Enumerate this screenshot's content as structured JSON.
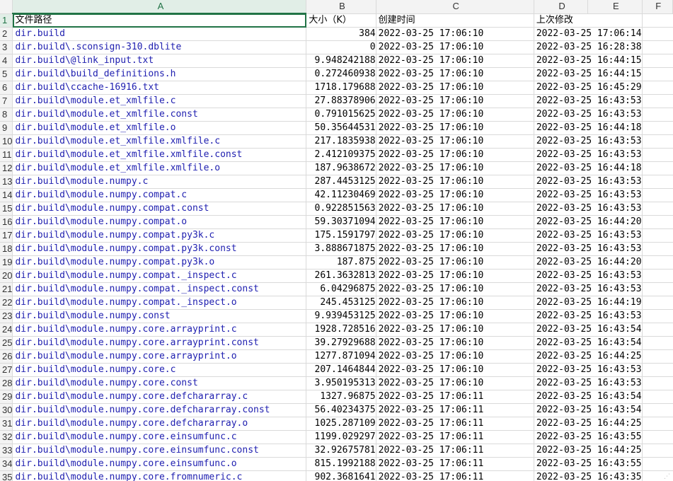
{
  "columns": [
    "A",
    "B",
    "C",
    "D",
    "E",
    "F"
  ],
  "selected_column": "A",
  "header_row": {
    "row": "1",
    "path": "文件路径",
    "size": "大小（K）",
    "created": "创建时间",
    "modified": "上次修改"
  },
  "rows": [
    {
      "row": "2",
      "path": "dir.build",
      "size": "384",
      "created": "2022-03-25 17:06:10",
      "modified": "2022-03-25 17:06:14"
    },
    {
      "row": "3",
      "path": "dir.build\\.sconsign-310.dblite",
      "size": "0",
      "created": "2022-03-25 17:06:10",
      "modified": "2022-03-25 16:28:38"
    },
    {
      "row": "4",
      "path": "dir.build\\@link_input.txt",
      "size": "9.948242188",
      "created": "2022-03-25 17:06:10",
      "modified": "2022-03-25 16:44:15"
    },
    {
      "row": "5",
      "path": "dir.build\\build_definitions.h",
      "size": "0.272460938",
      "created": "2022-03-25 17:06:10",
      "modified": "2022-03-25 16:44:15"
    },
    {
      "row": "6",
      "path": "dir.build\\ccache-16916.txt",
      "size": "1718.179688",
      "created": "2022-03-25 17:06:10",
      "modified": "2022-03-25 16:45:29"
    },
    {
      "row": "7",
      "path": "dir.build\\module.et_xmlfile.c",
      "size": "27.88378906",
      "created": "2022-03-25 17:06:10",
      "modified": "2022-03-25 16:43:53"
    },
    {
      "row": "8",
      "path": "dir.build\\module.et_xmlfile.const",
      "size": "0.791015625",
      "created": "2022-03-25 17:06:10",
      "modified": "2022-03-25 16:43:53"
    },
    {
      "row": "9",
      "path": "dir.build\\module.et_xmlfile.o",
      "size": "50.35644531",
      "created": "2022-03-25 17:06:10",
      "modified": "2022-03-25 16:44:18"
    },
    {
      "row": "10",
      "path": "dir.build\\module.et_xmlfile.xmlfile.c",
      "size": "217.1835938",
      "created": "2022-03-25 17:06:10",
      "modified": "2022-03-25 16:43:53"
    },
    {
      "row": "11",
      "path": "dir.build\\module.et_xmlfile.xmlfile.const",
      "size": "2.412109375",
      "created": "2022-03-25 17:06:10",
      "modified": "2022-03-25 16:43:53"
    },
    {
      "row": "12",
      "path": "dir.build\\module.et_xmlfile.xmlfile.o",
      "size": "187.9638672",
      "created": "2022-03-25 17:06:10",
      "modified": "2022-03-25 16:44:18"
    },
    {
      "row": "13",
      "path": "dir.build\\module.numpy.c",
      "size": "287.4453125",
      "created": "2022-03-25 17:06:10",
      "modified": "2022-03-25 16:43:53"
    },
    {
      "row": "14",
      "path": "dir.build\\module.numpy.compat.c",
      "size": "42.11230469",
      "created": "2022-03-25 17:06:10",
      "modified": "2022-03-25 16:43:53"
    },
    {
      "row": "15",
      "path": "dir.build\\module.numpy.compat.const",
      "size": "0.922851563",
      "created": "2022-03-25 17:06:10",
      "modified": "2022-03-25 16:43:53"
    },
    {
      "row": "16",
      "path": "dir.build\\module.numpy.compat.o",
      "size": "59.30371094",
      "created": "2022-03-25 17:06:10",
      "modified": "2022-03-25 16:44:20"
    },
    {
      "row": "17",
      "path": "dir.build\\module.numpy.compat.py3k.c",
      "size": "175.1591797",
      "created": "2022-03-25 17:06:10",
      "modified": "2022-03-25 16:43:53"
    },
    {
      "row": "18",
      "path": "dir.build\\module.numpy.compat.py3k.const",
      "size": "3.888671875",
      "created": "2022-03-25 17:06:10",
      "modified": "2022-03-25 16:43:53"
    },
    {
      "row": "19",
      "path": "dir.build\\module.numpy.compat.py3k.o",
      "size": "187.875",
      "created": "2022-03-25 17:06:10",
      "modified": "2022-03-25 16:44:20"
    },
    {
      "row": "20",
      "path": "dir.build\\module.numpy.compat._inspect.c",
      "size": "261.3632813",
      "created": "2022-03-25 17:06:10",
      "modified": "2022-03-25 16:43:53"
    },
    {
      "row": "21",
      "path": "dir.build\\module.numpy.compat._inspect.const",
      "size": "6.04296875",
      "created": "2022-03-25 17:06:10",
      "modified": "2022-03-25 16:43:53"
    },
    {
      "row": "22",
      "path": "dir.build\\module.numpy.compat._inspect.o",
      "size": "245.453125",
      "created": "2022-03-25 17:06:10",
      "modified": "2022-03-25 16:44:19"
    },
    {
      "row": "23",
      "path": "dir.build\\module.numpy.const",
      "size": "9.939453125",
      "created": "2022-03-25 17:06:10",
      "modified": "2022-03-25 16:43:53"
    },
    {
      "row": "24",
      "path": "dir.build\\module.numpy.core.arrayprint.c",
      "size": "1928.728516",
      "created": "2022-03-25 17:06:10",
      "modified": "2022-03-25 16:43:54"
    },
    {
      "row": "25",
      "path": "dir.build\\module.numpy.core.arrayprint.const",
      "size": "39.27929688",
      "created": "2022-03-25 17:06:10",
      "modified": "2022-03-25 16:43:54"
    },
    {
      "row": "26",
      "path": "dir.build\\module.numpy.core.arrayprint.o",
      "size": "1277.871094",
      "created": "2022-03-25 17:06:10",
      "modified": "2022-03-25 16:44:25"
    },
    {
      "row": "27",
      "path": "dir.build\\module.numpy.core.c",
      "size": "207.1464844",
      "created": "2022-03-25 17:06:10",
      "modified": "2022-03-25 16:43:53"
    },
    {
      "row": "28",
      "path": "dir.build\\module.numpy.core.const",
      "size": "3.950195313",
      "created": "2022-03-25 17:06:10",
      "modified": "2022-03-25 16:43:53"
    },
    {
      "row": "29",
      "path": "dir.build\\module.numpy.core.defchararray.c",
      "size": "1327.96875",
      "created": "2022-03-25 17:06:11",
      "modified": "2022-03-25 16:43:54"
    },
    {
      "row": "30",
      "path": "dir.build\\module.numpy.core.defchararray.const",
      "size": "56.40234375",
      "created": "2022-03-25 17:06:11",
      "modified": "2022-03-25 16:43:54"
    },
    {
      "row": "31",
      "path": "dir.build\\module.numpy.core.defchararray.o",
      "size": "1025.287109",
      "created": "2022-03-25 17:06:11",
      "modified": "2022-03-25 16:44:25"
    },
    {
      "row": "32",
      "path": "dir.build\\module.numpy.core.einsumfunc.c",
      "size": "1199.029297",
      "created": "2022-03-25 17:06:11",
      "modified": "2022-03-25 16:43:55"
    },
    {
      "row": "33",
      "path": "dir.build\\module.numpy.core.einsumfunc.const",
      "size": "32.92675781",
      "created": "2022-03-25 17:06:11",
      "modified": "2022-03-25 16:44:25"
    },
    {
      "row": "34",
      "path": "dir.build\\module.numpy.core.einsumfunc.o",
      "size": "815.1992188",
      "created": "2022-03-25 17:06:11",
      "modified": "2022-03-25 16:43:55"
    },
    {
      "row": "35",
      "path": "dir.build\\module.numpy.core.fromnumeric.c",
      "size": "902.3681641",
      "created": "2022-03-25 17:06:11",
      "modified": "2022-03-25 16:43:35"
    }
  ]
}
